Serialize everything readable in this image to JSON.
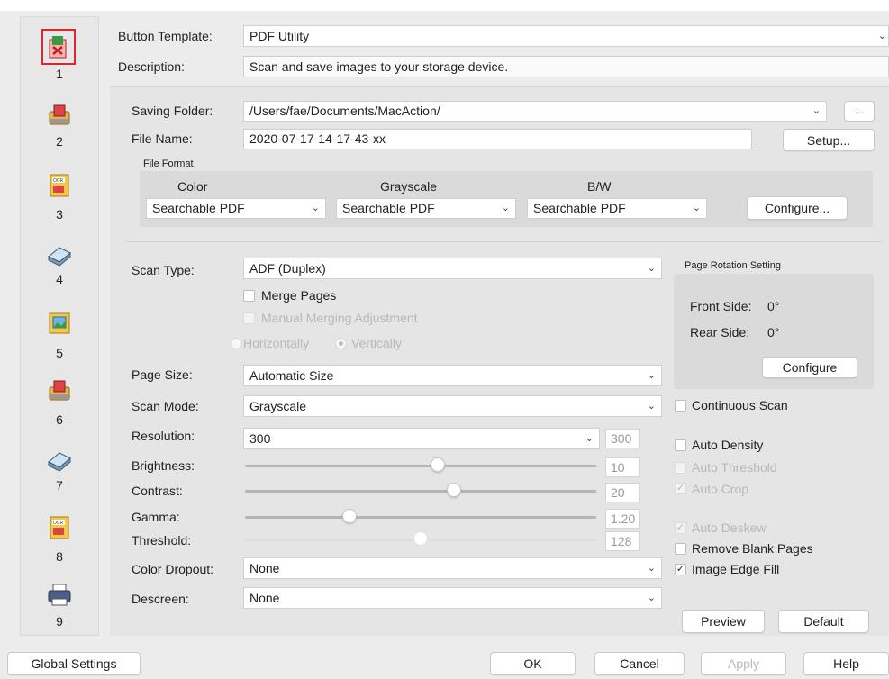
{
  "sidebar": {
    "buttons": [
      {
        "number": "1",
        "icon": "pdf-utility-icon",
        "selected": true
      },
      {
        "number": "2",
        "icon": "scan-to-folder-icon"
      },
      {
        "number": "3",
        "icon": "ocr-icon"
      },
      {
        "number": "4",
        "icon": "scanner-icon"
      },
      {
        "number": "5",
        "icon": "image-icon"
      },
      {
        "number": "6",
        "icon": "scan-to-folder-icon"
      },
      {
        "number": "7",
        "icon": "scanner-icon"
      },
      {
        "number": "8",
        "icon": "ocr-icon"
      },
      {
        "number": "9",
        "icon": "printer-icon"
      }
    ],
    "selected_color": "#e0262b"
  },
  "header": {
    "button_template_label": "Button Template:",
    "button_template_value": "PDF Utility",
    "description_label": "Description:",
    "description_value": "Scan and save images to your storage device."
  },
  "saving": {
    "folder_label": "Saving Folder:",
    "folder_value": "/Users/fae/Documents/MacAction/",
    "browse_label": "...",
    "file_name_label": "File Name:",
    "file_name_value": "2020-07-17-14-17-43-xx",
    "setup_label": "Setup..."
  },
  "file_format": {
    "group_label": "File Format",
    "color_label": "Color",
    "grayscale_label": "Grayscale",
    "bw_label": "B/W",
    "color_value": "Searchable PDF",
    "grayscale_value": "Searchable PDF",
    "bw_value": "Searchable PDF",
    "configure_label": "Configure..."
  },
  "scan": {
    "scan_type_label": "Scan Type:",
    "scan_type_value": "ADF (Duplex)",
    "merge_pages_label": "Merge Pages",
    "manual_merge_label": "Manual Merging Adjustment",
    "horizontally_label": "Horizontally",
    "vertically_label": "Vertically",
    "page_size_label": "Page Size:",
    "page_size_value": "Automatic Size",
    "scan_mode_label": "Scan Mode:",
    "scan_mode_value": "Grayscale",
    "resolution_label": "Resolution:",
    "resolution_value": "300",
    "resolution_number": "300",
    "brightness_label": "Brightness:",
    "brightness_value": "10",
    "contrast_label": "Contrast:",
    "contrast_value": "20",
    "gamma_label": "Gamma:",
    "gamma_value": "1.20",
    "threshold_label": "Threshold:",
    "threshold_value": "128",
    "color_dropout_label": "Color Dropout:",
    "color_dropout_value": "None",
    "descreen_label": "Descreen:",
    "descreen_value": "None"
  },
  "rotation": {
    "group_label": "Page Rotation Setting",
    "front_label": "Front Side:",
    "front_value": "0°",
    "rear_label": "Rear Side:",
    "rear_value": "0°",
    "configure_label": "Configure"
  },
  "options": {
    "continuous_scan": "Continuous Scan",
    "auto_density": "Auto Density",
    "auto_threshold": "Auto Threshold",
    "auto_crop": "Auto Crop",
    "auto_deskew": "Auto Deskew",
    "remove_blank": "Remove Blank Pages",
    "image_edge_fill": "Image Edge Fill",
    "checkmark": "✓"
  },
  "actions": {
    "preview": "Preview",
    "default": "Default",
    "global_settings": "Global Settings",
    "ok": "OK",
    "cancel": "Cancel",
    "apply": "Apply",
    "help": "Help"
  }
}
